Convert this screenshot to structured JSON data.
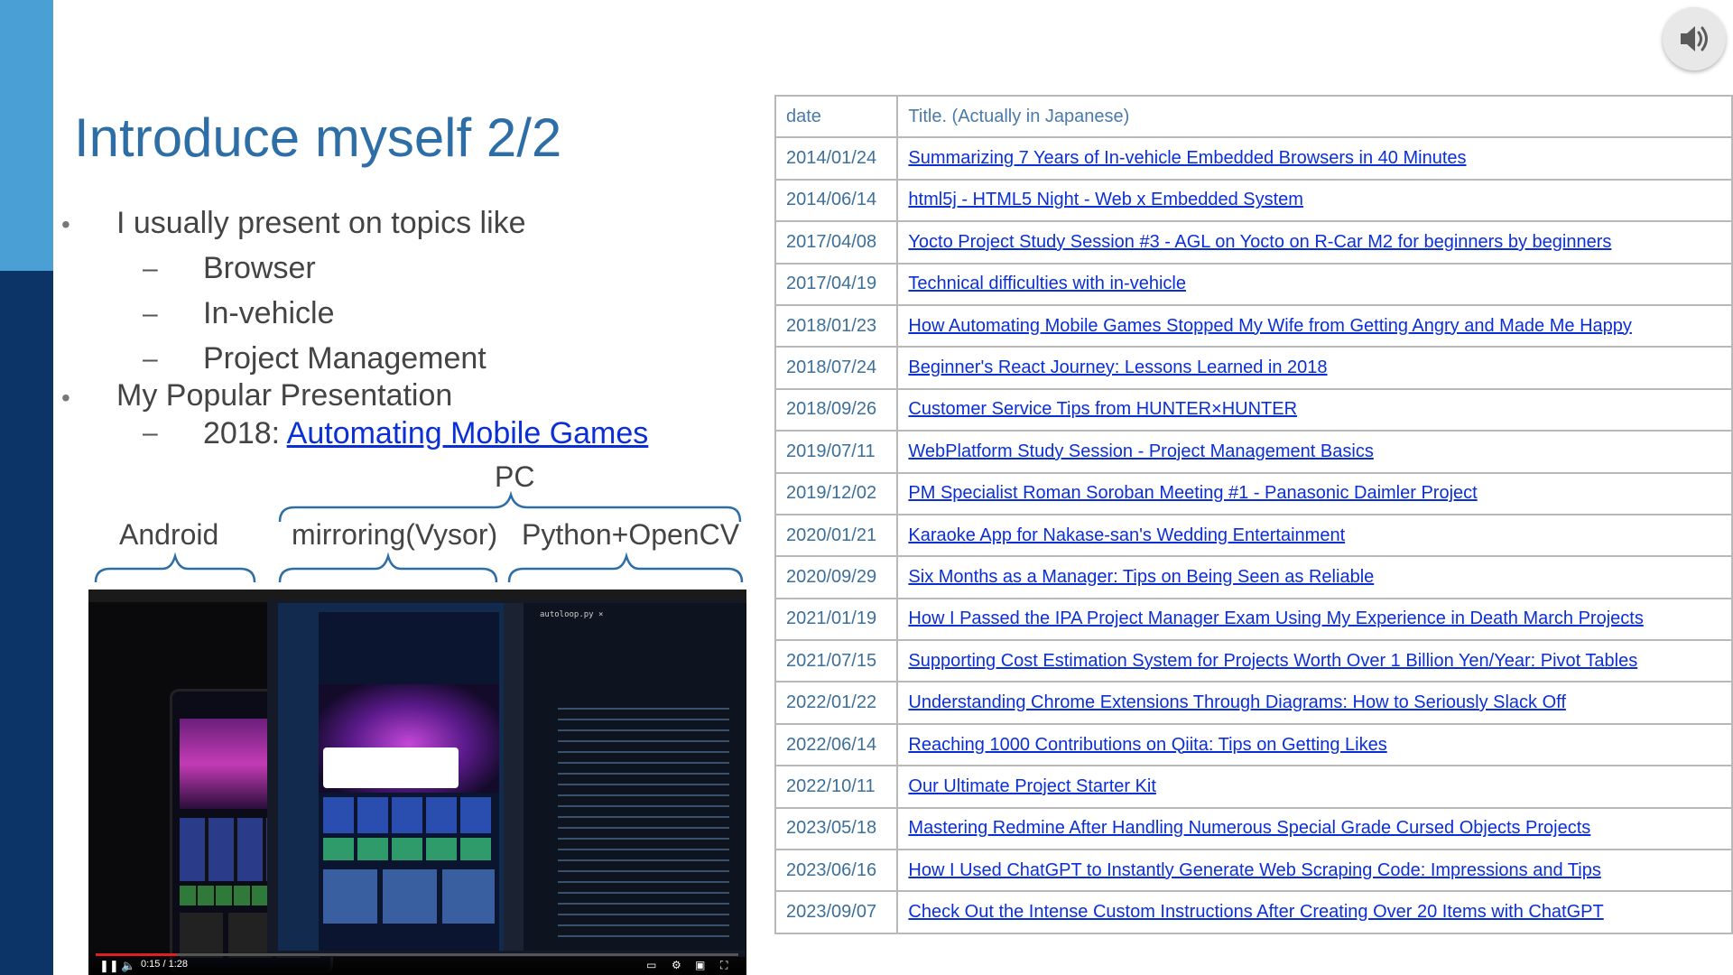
{
  "slide": {
    "title": "Introduce myself 2/2",
    "bullet1": "I usually present on topics like",
    "topics": [
      "Browser",
      "In-vehicle",
      "Project Management"
    ],
    "bullet2": "My Popular Presentation",
    "popular_prefix": "2018: ",
    "popular_link": "Automating Mobile Games"
  },
  "diagram": {
    "pc_label": "PC",
    "android_label": "Android",
    "mirroring_label": "mirroring(Vysor)",
    "python_label": "Python+OpenCV"
  },
  "video": {
    "time": "0:15 / 1:28",
    "code_tab": "autoloop.py ×"
  },
  "speaker": {
    "icon": "speaker-icon"
  },
  "table": {
    "header": {
      "date": "date",
      "title": "Title. (Actually in Japanese)"
    },
    "rows": [
      {
        "date": "2014/01/24",
        "title": "Summarizing 7 Years of In-vehicle Embedded Browsers in 40 Minutes"
      },
      {
        "date": "2014/06/14",
        "title": "html5j - HTML5 Night - Web x Embedded System"
      },
      {
        "date": "2017/04/08",
        "title": "Yocto Project Study Session #3 - AGL on Yocto on R-Car M2 for beginners by beginners"
      },
      {
        "date": "2017/04/19",
        "title": "Technical difficulties with in-vehicle"
      },
      {
        "date": "2018/01/23",
        "title": "How Automating Mobile Games Stopped My Wife from Getting Angry and Made Me Happy"
      },
      {
        "date": "2018/07/24",
        "title": "Beginner's React Journey: Lessons Learned in 2018"
      },
      {
        "date": "2018/09/26",
        "title": "Customer Service Tips from HUNTER×HUNTER"
      },
      {
        "date": "2019/07/11",
        "title": "WebPlatform Study Session - Project Management Basics"
      },
      {
        "date": "2019/12/02",
        "title": "PM Specialist Roman Soroban Meeting #1 - Panasonic Daimler Project"
      },
      {
        "date": "2020/01/21",
        "title": "Karaoke App for Nakase-san's Wedding Entertainment"
      },
      {
        "date": "2020/09/29",
        "title": "Six Months as a Manager: Tips on Being Seen as Reliable"
      },
      {
        "date": "2021/01/19",
        "title": "How I Passed the IPA Project Manager Exam Using My Experience in Death March Projects"
      },
      {
        "date": "2021/07/15",
        "title": "Supporting Cost Estimation System for Projects Worth Over 1 Billion Yen/Year: Pivot Tables"
      },
      {
        "date": "2022/01/22",
        "title": "Understanding Chrome Extensions Through Diagrams: How to Seriously Slack Off"
      },
      {
        "date": "2022/06/14",
        "title": "Reaching 1000 Contributions on Qiita: Tips on Getting Likes"
      },
      {
        "date": "2022/10/11",
        "title": "Our Ultimate Project Starter Kit"
      },
      {
        "date": "2023/05/18",
        "title": "Mastering Redmine After Handling Numerous Special Grade Cursed Objects Projects"
      },
      {
        "date": "2023/06/16",
        "title": "How I Used ChatGPT to Instantly Generate Web Scraping Code: Impressions and Tips"
      },
      {
        "date": "2023/09/07",
        "title": "Check Out the Intense Custom Instructions After Creating Over 20 Items with ChatGPT"
      }
    ]
  }
}
